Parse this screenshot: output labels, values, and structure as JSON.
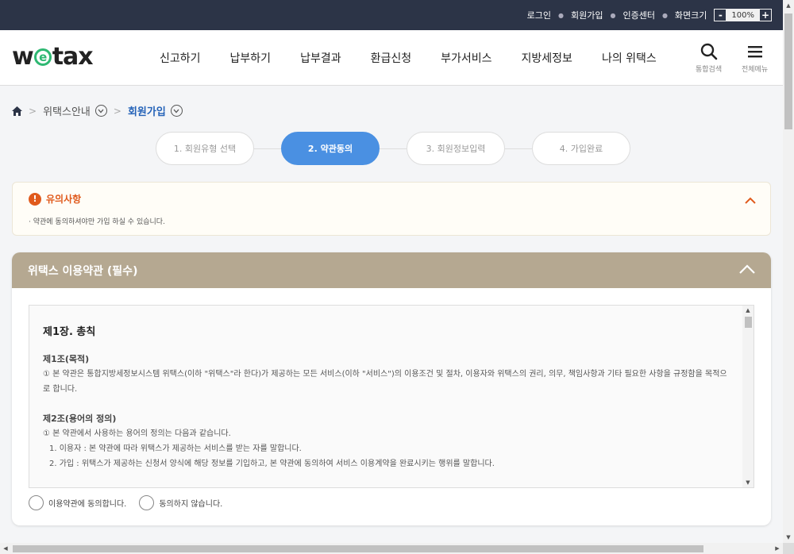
{
  "topbar": {
    "links": [
      "로그인",
      "회원가입",
      "인증센터",
      "화면크기"
    ],
    "zoom_minus": "-",
    "zoom_value": "100%",
    "zoom_plus": "+"
  },
  "header": {
    "logo_w": "w",
    "logo_e": "e",
    "logo_rest": "tax",
    "nav": [
      "신고하기",
      "납부하기",
      "납부결과",
      "환급신청",
      "부가서비스",
      "지방세정보",
      "나의 위택스"
    ],
    "search_label": "통합검색",
    "menu_label": "전체메뉴"
  },
  "breadcrumb": {
    "level1": "위택스안내",
    "level2": "회원가입"
  },
  "steps": [
    "1. 회원유형 선택",
    "2. 약관동의",
    "3. 회원정보입력",
    "4. 가입완료"
  ],
  "active_step": 1,
  "notice": {
    "title": "유의사항",
    "text": "· 약관에 동의하셔야만 가입 하실 수 있습니다."
  },
  "terms": {
    "title": "위택스 이용약관 (필수)",
    "chapter": "제1장. 총칙",
    "art1_title": "제1조(목적)",
    "art1_text": "① 본 약관은 통합지방세정보시스템 위택스(이하 \"위택스\"라 한다)가 제공하는 모든 서비스(이하 \"서비스\")의 이용조건 및 절차, 이용자와 위택스의 권리, 의무, 책임사항과 기타 필요한 사항을 규정함을 목적으로 합니다.",
    "art2_title": "제2조(용어의 정의)",
    "art2_text": "① 본 약관에서 사용하는 용어의 정의는 다음과 같습니다.",
    "art2_item1": "1. 이용자 : 본 약관에 따라 위택스가 제공하는 서비스를 받는 자를 말합니다.",
    "art2_item2": "2. 가입 : 위택스가 제공하는 신청서 양식에 해당 정보를 기입하고, 본 약관에 동의하여 서비스 이용계약을 완료시키는 행위를 말합니다.",
    "agree_label": "이용약관에 동의합니다.",
    "disagree_label": "동의하지 않습니다."
  }
}
